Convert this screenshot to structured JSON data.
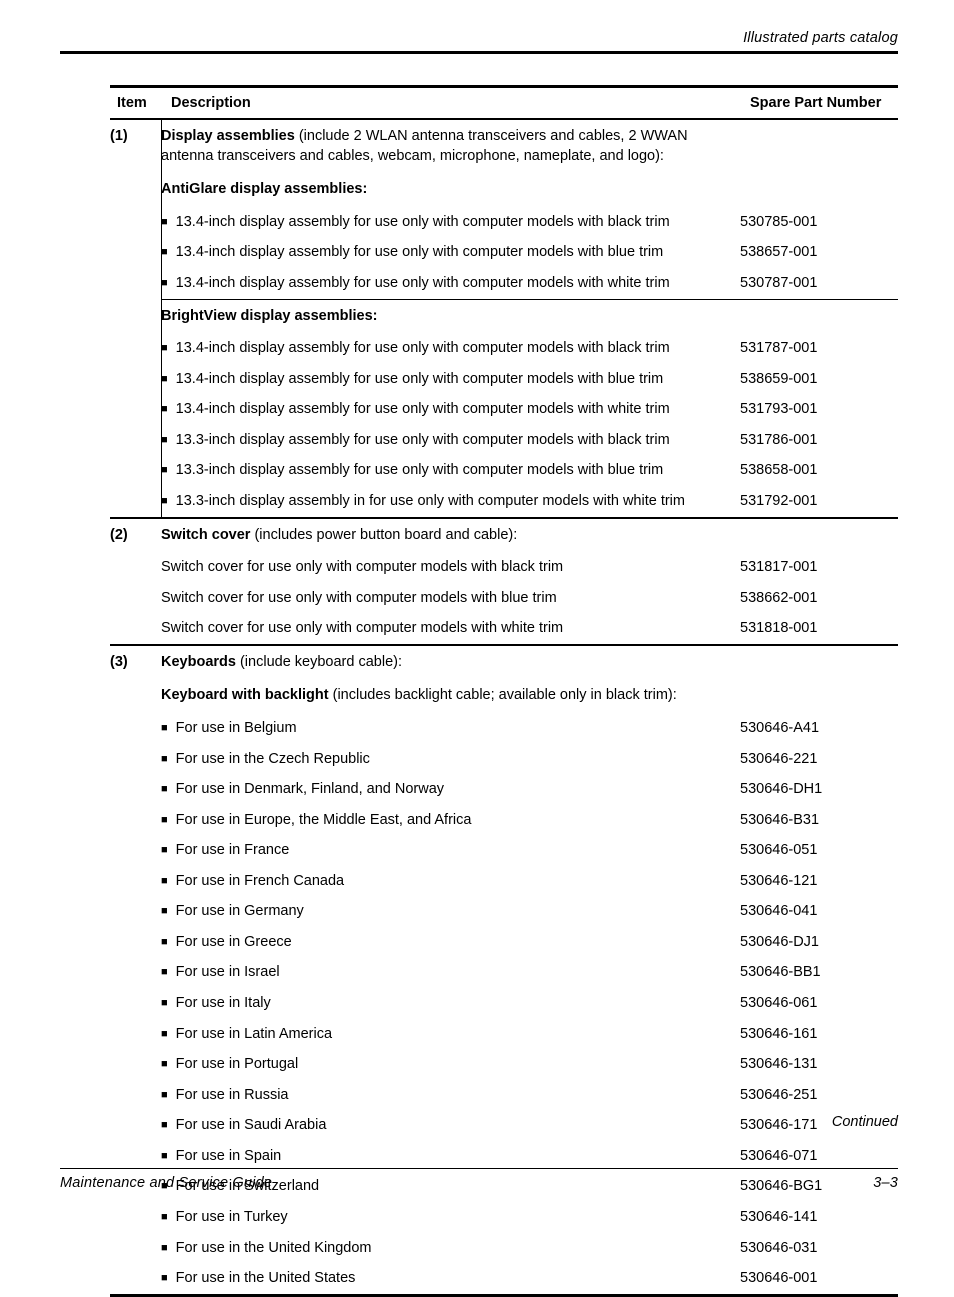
{
  "header": {
    "running_head": "Illustrated parts catalog"
  },
  "table": {
    "columns": {
      "item": "Item",
      "description": "Description",
      "spare_part_number": "Spare Part Number"
    },
    "sections": [
      {
        "item": "(1)",
        "title_bold": "Display assemblies",
        "title_rest": " (include 2 WLAN antenna transceivers and cables, 2 WWAN antenna transceivers and cables, webcam, microphone, nameplate, and logo):",
        "groups": [
          {
            "subhead": "AntiGlare display assemblies:",
            "rows": [
              {
                "bullet": "■",
                "desc": "13.4-inch display assembly for use only with computer models with black trim",
                "part": "530785-001"
              },
              {
                "bullet": "■",
                "desc": "13.4-inch display assembly for use only with computer models with blue trim",
                "part": "538657-001"
              },
              {
                "bullet": "■",
                "desc": "13.4-inch display assembly for use only with computer models with white trim",
                "part": "530787-001"
              }
            ]
          },
          {
            "subhead": "BrightView display assemblies:",
            "rows": [
              {
                "bullet": "■",
                "desc": "13.4-inch display assembly for use only with computer models with black trim",
                "part": "531787-001"
              },
              {
                "bullet": "■",
                "desc": "13.4-inch display assembly for use only with computer models with blue trim",
                "part": "538659-001"
              },
              {
                "bullet": "■",
                "desc": "13.4-inch display assembly for use only with computer models with white trim",
                "part": "531793-001"
              },
              {
                "bullet": "■",
                "desc": "13.3-inch display assembly for use only with computer models with black trim",
                "part": "531786-001"
              },
              {
                "bullet": "■",
                "desc": "13.3-inch display assembly for use only with computer models with blue trim",
                "part": "538658-001"
              },
              {
                "bullet": "■",
                "desc": "13.3-inch display assembly in for use only with computer models with white trim",
                "part": "531792-001"
              }
            ]
          }
        ]
      },
      {
        "item": "(2)",
        "title_bold": "Switch cover",
        "title_rest": " (includes power button board and cable):",
        "groups": [
          {
            "subhead": "",
            "rows": [
              {
                "bullet": "",
                "desc": "Switch cover for use only with computer models with black trim",
                "part": "531817-001"
              },
              {
                "bullet": "",
                "desc": "Switch cover for use only with computer models with blue trim",
                "part": "538662-001"
              },
              {
                "bullet": "",
                "desc": "Switch cover for use only with computer models with white trim",
                "part": "531818-001"
              }
            ]
          }
        ]
      },
      {
        "item": "(3)",
        "title_bold": "Keyboards",
        "title_rest": " (include keyboard cable):",
        "groups": [
          {
            "subhead_bold": "Keyboard with backlight",
            "subhead_rest": " (includes backlight cable; available only in black trim):",
            "rows": [
              {
                "bullet": "■",
                "desc": "For use in Belgium",
                "part": "530646-A41"
              },
              {
                "bullet": "■",
                "desc": "For use in the Czech Republic",
                "part": "530646-221"
              },
              {
                "bullet": "■",
                "desc": "For use in Denmark, Finland, and Norway",
                "part": "530646-DH1"
              },
              {
                "bullet": "■",
                "desc": "For use in Europe, the Middle East, and Africa",
                "part": "530646-B31"
              },
              {
                "bullet": "■",
                "desc": "For use in France",
                "part": "530646-051"
              },
              {
                "bullet": "■",
                "desc": "For use in French Canada",
                "part": "530646-121"
              },
              {
                "bullet": "■",
                "desc": "For use in Germany",
                "part": "530646-041"
              },
              {
                "bullet": "■",
                "desc": "For use in Greece",
                "part": "530646-DJ1"
              },
              {
                "bullet": "■",
                "desc": "For use in Israel",
                "part": "530646-BB1"
              },
              {
                "bullet": "■",
                "desc": "For use in Italy",
                "part": "530646-061"
              },
              {
                "bullet": "■",
                "desc": "For use in Latin America",
                "part": "530646-161"
              },
              {
                "bullet": "■",
                "desc": "For use in Portugal",
                "part": "530646-131"
              },
              {
                "bullet": "■",
                "desc": "For use in Russia",
                "part": "530646-251"
              },
              {
                "bullet": "■",
                "desc": "For use in Saudi Arabia",
                "part": "530646-171"
              },
              {
                "bullet": "■",
                "desc": "For use in Spain",
                "part": "530646-071"
              },
              {
                "bullet": "■",
                "desc": "For use in Switzerland",
                "part": "530646-BG1"
              },
              {
                "bullet": "■",
                "desc": "For use in Turkey",
                "part": "530646-141"
              },
              {
                "bullet": "■",
                "desc": "For use in the United Kingdom",
                "part": "530646-031"
              },
              {
                "bullet": "■",
                "desc": "For use in the United States",
                "part": "530646-001"
              }
            ]
          }
        ]
      }
    ]
  },
  "footer": {
    "continued": "Continued",
    "guide_title": "Maintenance and Service Guide",
    "page_number": "3–3"
  }
}
